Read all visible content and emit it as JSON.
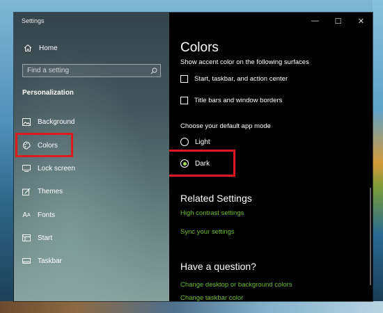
{
  "window": {
    "title": "Settings",
    "controls": {
      "minimize": "—",
      "maximize": "☐",
      "close": "✕"
    }
  },
  "sidebar": {
    "home_label": "Home",
    "search_placeholder": "Find a setting",
    "section_label": "Personalization",
    "items": [
      {
        "label": "Background",
        "icon": "image-icon"
      },
      {
        "label": "Colors",
        "icon": "palette-icon"
      },
      {
        "label": "Lock screen",
        "icon": "lock-screen-icon"
      },
      {
        "label": "Themes",
        "icon": "themes-icon"
      },
      {
        "label": "Fonts",
        "icon": "fonts-icon"
      },
      {
        "label": "Start",
        "icon": "start-icon"
      },
      {
        "label": "Taskbar",
        "icon": "taskbar-icon"
      }
    ]
  },
  "main": {
    "title": "Colors",
    "accent_surfaces_label": "Show accent color on the following surfaces",
    "checkboxes": [
      {
        "label": "Start, taskbar, and action center",
        "checked": false
      },
      {
        "label": "Title bars and window borders",
        "checked": false
      }
    ],
    "app_mode_label": "Choose your default app mode",
    "app_mode_options": [
      {
        "label": "Light",
        "selected": false
      },
      {
        "label": "Dark",
        "selected": true
      }
    ],
    "related_heading": "Related Settings",
    "related_links": [
      "High contrast settings",
      "Sync your settings"
    ],
    "question_heading": "Have a question?",
    "question_links": [
      "Change desktop or background colors",
      "Change taskbar color"
    ]
  },
  "colors": {
    "accent_link": "#6bbf2a",
    "highlight": "#e0191f",
    "radio_dot": "#9ee04a"
  }
}
